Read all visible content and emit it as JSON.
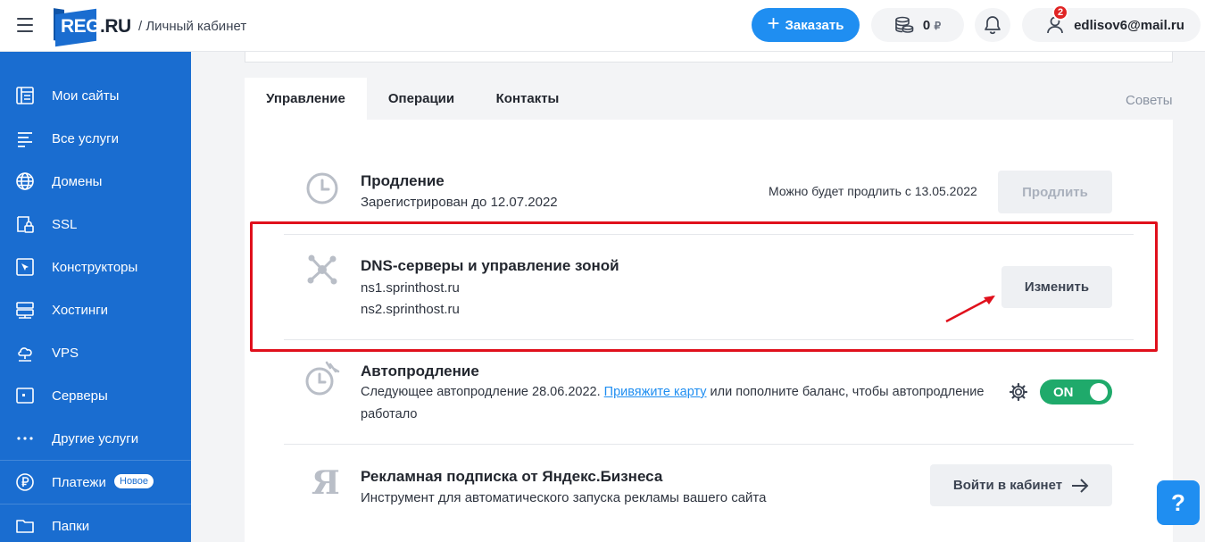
{
  "header": {
    "logo_text": "REG",
    "logo_suffix": ".RU",
    "subtitle": "/ Личный кабинет",
    "order_button": "Заказать",
    "balance": "0",
    "balance_currency": "₽",
    "notifications_count": "2",
    "user_email": "edlisov6@mail.ru"
  },
  "sidebar": {
    "items": [
      {
        "label": "Мои сайты",
        "icon": "sites-icon"
      },
      {
        "label": "Все услуги",
        "icon": "list-icon"
      },
      {
        "label": "Домены",
        "icon": "globe-icon"
      },
      {
        "label": "SSL",
        "icon": "ssl-lock-icon"
      },
      {
        "label": "Конструкторы",
        "icon": "builder-icon"
      },
      {
        "label": "Хостинги",
        "icon": "hosting-icon"
      },
      {
        "label": "VPS",
        "icon": "vps-cloud-icon"
      },
      {
        "label": "Серверы",
        "icon": "server-icon"
      },
      {
        "label": "Другие услуги",
        "icon": "more-dots-icon"
      },
      {
        "label": "Платежи",
        "icon": "ruble-icon",
        "badge": "Новое"
      },
      {
        "label": "Папки",
        "icon": "folder-icon"
      }
    ]
  },
  "tabs": [
    {
      "label": "Управление",
      "active": true
    },
    {
      "label": "Операции",
      "active": false
    },
    {
      "label": "Контакты",
      "active": false
    }
  ],
  "tips_label": "Советы",
  "renewal": {
    "title": "Продление",
    "subtitle": "Зарегистрирован до 12.07.2022",
    "note": "Можно будет продлить с 13.05.2022",
    "button": "Продлить"
  },
  "dns": {
    "title": "DNS-серверы и управление зоной",
    "ns1": "ns1.sprinthost.ru",
    "ns2": "ns2.sprinthost.ru",
    "button": "Изменить"
  },
  "autorenew": {
    "title": "Автопродление",
    "text_before": "Следующее автопродление 28.06.2022. ",
    "link": "Привяжите карту",
    "text_after": " или пополните баланс, чтобы автопродление",
    "text_line2": "работало",
    "toggle": "ON"
  },
  "yandex": {
    "title": "Рекламная подписка от Яндекс.Бизнеса",
    "subtitle": "Инструмент для автоматического запуска рекламы вашего сайта",
    "logo_letter": "Я",
    "button": "Войти в кабинет"
  },
  "help_label": "?",
  "colors": {
    "brand_blue": "#1a6dd0",
    "accent_blue": "#1f8ef1",
    "toggle_green": "#1faa6b",
    "highlight_red": "#e0101c"
  }
}
